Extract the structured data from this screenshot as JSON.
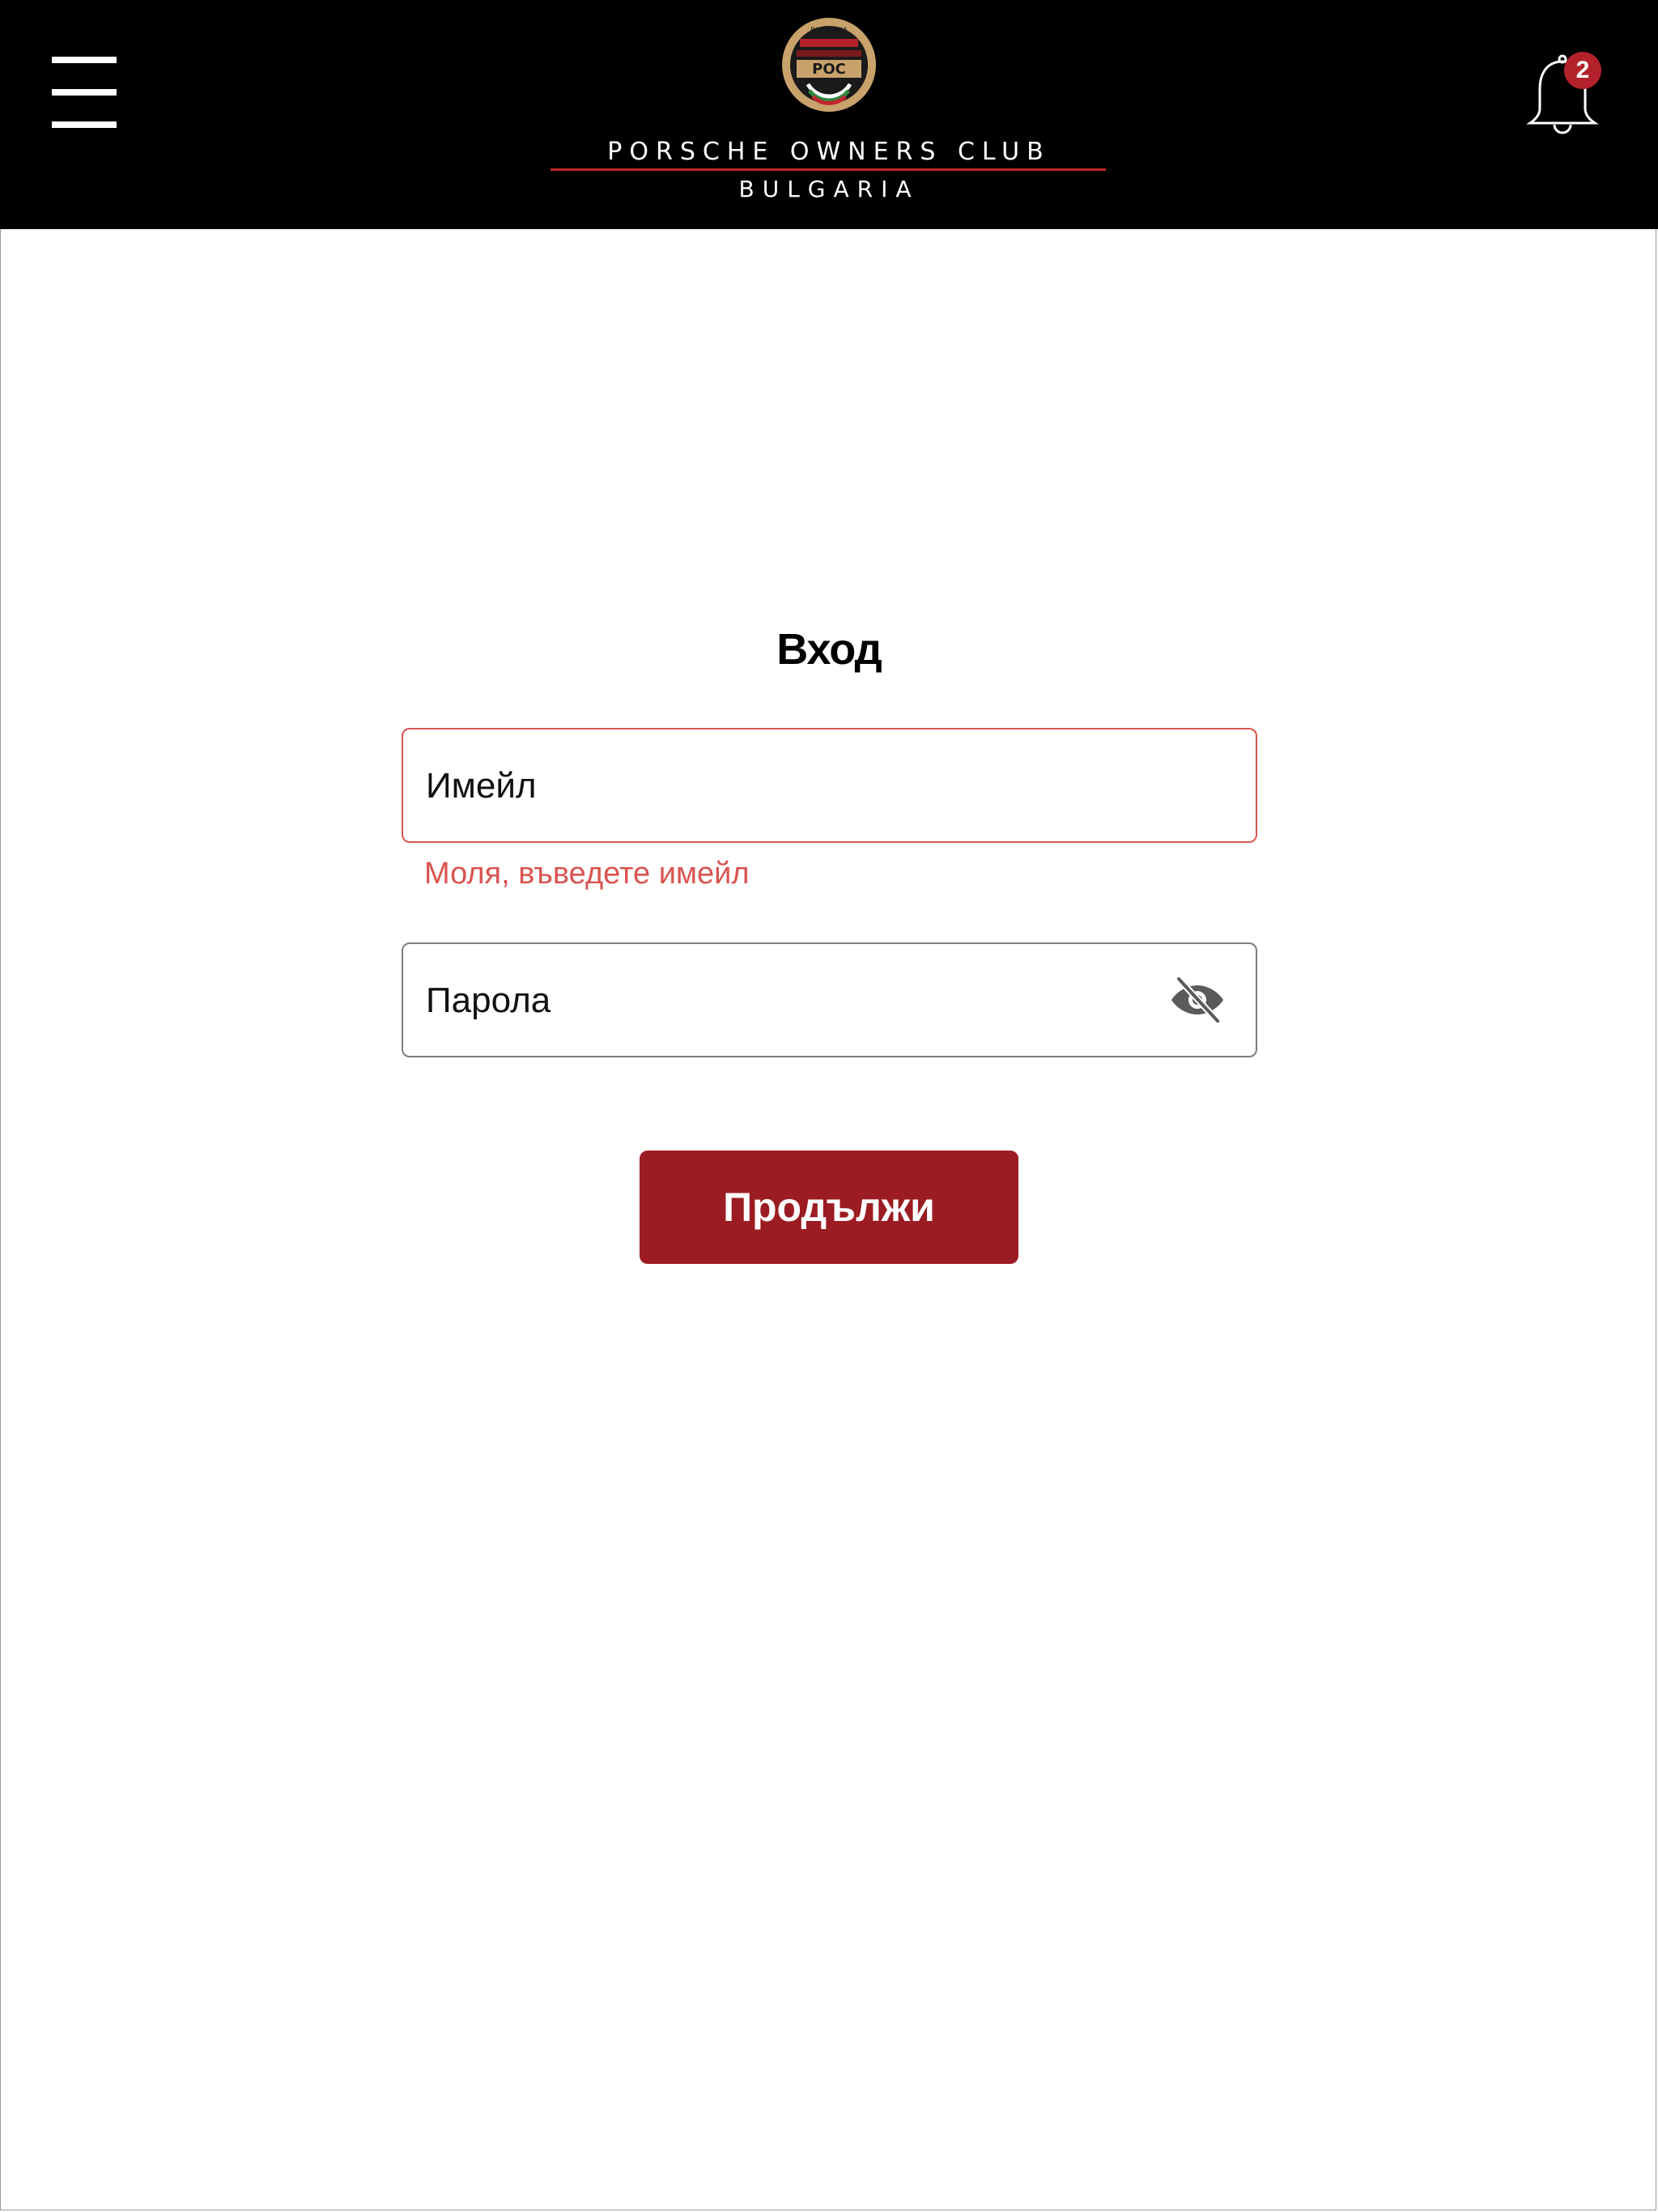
{
  "header": {
    "menu_icon": "hamburger-menu-icon",
    "logo": {
      "emblem_text_top": "BULGARIA",
      "emblem_text_center": "POC",
      "title": "PORSCHE OWNERS CLUB",
      "subtitle": "BULGARIA"
    },
    "notifications": {
      "icon": "bell-icon",
      "count": "2"
    },
    "colors": {
      "background": "#000000",
      "accent": "#c0262e",
      "badge": "#b3212b",
      "emblem_gold": "#c9a26b"
    }
  },
  "login": {
    "title": "Вход",
    "email": {
      "placeholder": "Имейл",
      "value": "",
      "error": "Моля, въведете имейл",
      "error_color": "#d9544f"
    },
    "password": {
      "placeholder": "Парола",
      "value": "",
      "toggle_icon": "eye-slash-icon"
    },
    "submit_label": "Продължи",
    "submit_color": "#9b1c22"
  }
}
